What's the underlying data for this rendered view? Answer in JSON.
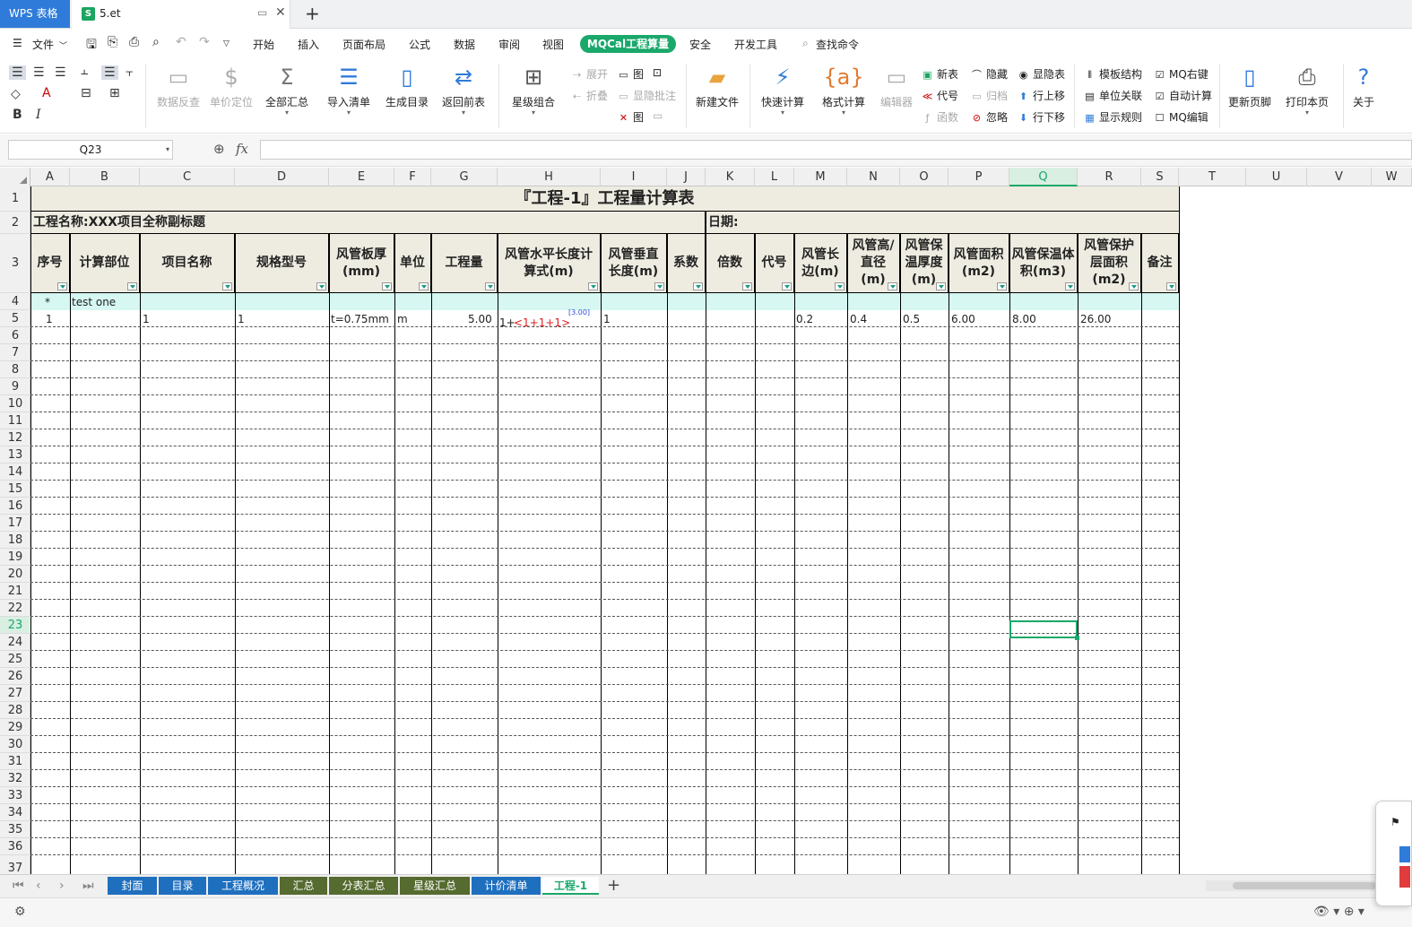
{
  "titlebar": {
    "app_name": "WPS 表格",
    "doc_tab": "5.et",
    "doc_icon": "S"
  },
  "menu": {
    "items": [
      "文件",
      "开始",
      "插入",
      "页面布局",
      "公式",
      "数据",
      "审阅",
      "视图",
      "MQCal工程算量",
      "安全",
      "开发工具"
    ],
    "search": "查找命令",
    "active_tab": "MQCal工程算量"
  },
  "ribbon": {
    "data_check": "数据反查",
    "unit_locate": "单价定位",
    "sum_all": "全部汇总",
    "import_list": "导入清单",
    "gen_toc": "生成目录",
    "back": "返回前表",
    "star_group": "星级组合",
    "expand": "展开",
    "fold": "折叠",
    "pic": "图",
    "show_hide_note": "显隐批注",
    "new_file": "新建文件",
    "quick_calc": "快速计算",
    "format_calc": "格式计算",
    "editor": "编辑器",
    "new_table": "新表",
    "code": "代号",
    "func": "函数",
    "hide": "隐藏",
    "archive": "归档",
    "ignore": "忽略",
    "show_hide_table": "显隐表",
    "row_up": "行上移",
    "row_down": "行下移",
    "template_struct": "模板结构",
    "unit_link": "单位关联",
    "show_rule": "显示规则",
    "mq_right": "MQ右键",
    "auto_calc": "自动计算",
    "mq_edit": "MQ编辑",
    "update_footer": "更新页脚",
    "print_page": "打印本页",
    "about": "关于"
  },
  "formula": {
    "cell_ref": "Q23",
    "fx": "fx",
    "content": ""
  },
  "columns": [
    "A",
    "B",
    "C",
    "D",
    "E",
    "F",
    "G",
    "H",
    "I",
    "J",
    "K",
    "L",
    "M",
    "N",
    "O",
    "P",
    "Q",
    "R",
    "S",
    "T",
    "U",
    "V",
    "W"
  ],
  "selected_column": "Q",
  "rows": [
    "1",
    "2",
    "3",
    "4",
    "5",
    "6",
    "7",
    "8",
    "9",
    "10",
    "11",
    "12",
    "13",
    "14",
    "15",
    "16",
    "17",
    "18",
    "19",
    "20",
    "21",
    "22",
    "23",
    "24",
    "25",
    "26",
    "27",
    "28",
    "29",
    "30",
    "31",
    "32",
    "33",
    "34",
    "35",
    "36",
    "37"
  ],
  "selected_row": "23",
  "sheet": {
    "title": "『工程-1』工程量计算表",
    "project": "工程名称:XXX项目全称副标题",
    "date": "日期:",
    "headers": [
      "序号",
      "计算部位",
      "项目名称",
      "规格型号",
      "风管板厚(mm)",
      "单位",
      "工程量",
      "风管水平长度计算式(m)",
      "风管垂直长度(m)",
      "系数",
      "倍数",
      "代号",
      "风管长边(m)",
      "风管高/直径(m)",
      "风管保温厚度(m)",
      "风管面积(m2)",
      "风管保温体积(m3)",
      "风管保护层面积(m2)",
      "备注"
    ],
    "row4": {
      "a": "*",
      "b": "test one"
    },
    "row5": {
      "seq": "1",
      "item_name": "1",
      "spec": "1",
      "thickness": "t=0.75mm",
      "unit": "m",
      "quantity": "5.00",
      "formula_prefix": "1+",
      "formula_red": "<1+1+1>",
      "formula_tag": "[3.00]",
      "vertical": "1",
      "long_side": "0.2",
      "height": "0.4",
      "insul_thick": "0.5",
      "area": "6.00",
      "insul_vol": "8.00",
      "protect_area": "26.00"
    }
  },
  "sheet_tabs": [
    {
      "label": "封面",
      "color": "#1f6fbf"
    },
    {
      "label": "目录",
      "color": "#1f6fbf"
    },
    {
      "label": "工程概况",
      "color": "#1f6fbf"
    },
    {
      "label": "汇总",
      "color": "#556b2f"
    },
    {
      "label": "分表汇总",
      "color": "#556b2f"
    },
    {
      "label": "星级汇总",
      "color": "#556b2f"
    },
    {
      "label": "计价清单",
      "color": "#1f6fbf"
    },
    {
      "label": "工程-1",
      "color": "#ffffff"
    }
  ],
  "accent": "#1aa86b"
}
